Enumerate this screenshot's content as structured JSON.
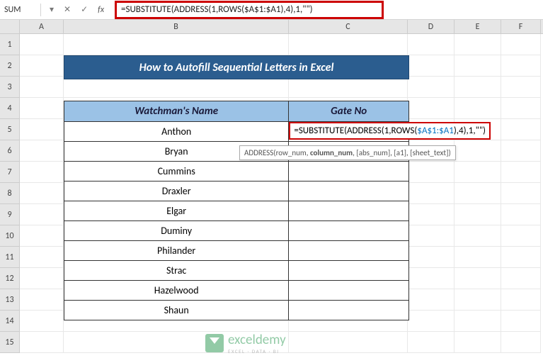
{
  "name_box": "SUM",
  "formula_bar": "=SUBSTITUTE(ADDRESS(1,ROWS($A$1:$A1),4),1,\"\")",
  "columns": [
    "A",
    "B",
    "C",
    "D",
    "E",
    "F"
  ],
  "rows": [
    "1",
    "2",
    "3",
    "4",
    "5",
    "6",
    "7",
    "8",
    "9",
    "10",
    "11",
    "12",
    "13",
    "14",
    "15"
  ],
  "title": "How to Autofill Sequential Letters in Excel",
  "headers": {
    "name": "Watchman's Name",
    "gate": "Gate No"
  },
  "names": [
    "Anthon",
    "Bryan",
    "Cummins",
    "Draxler",
    "Elgar",
    "Duminy",
    "Philander",
    "Strac",
    "Hazelwood",
    "Shaun"
  ],
  "editing_cell": {
    "prefix": "=SUBSTITUTE(ADDRESS(1,ROWS(",
    "ref": "$A$1:$A1",
    "suffix": "),4),1,\"\")"
  },
  "tooltip": {
    "fn": "ADDRESS(",
    "p1": "row_num, ",
    "p2": "column_num",
    "rest": ", [abs_num], [a1], [sheet_text])"
  },
  "watermark": {
    "brand": "exceldemy",
    "tag": "EXCEL · DATA · BI"
  }
}
